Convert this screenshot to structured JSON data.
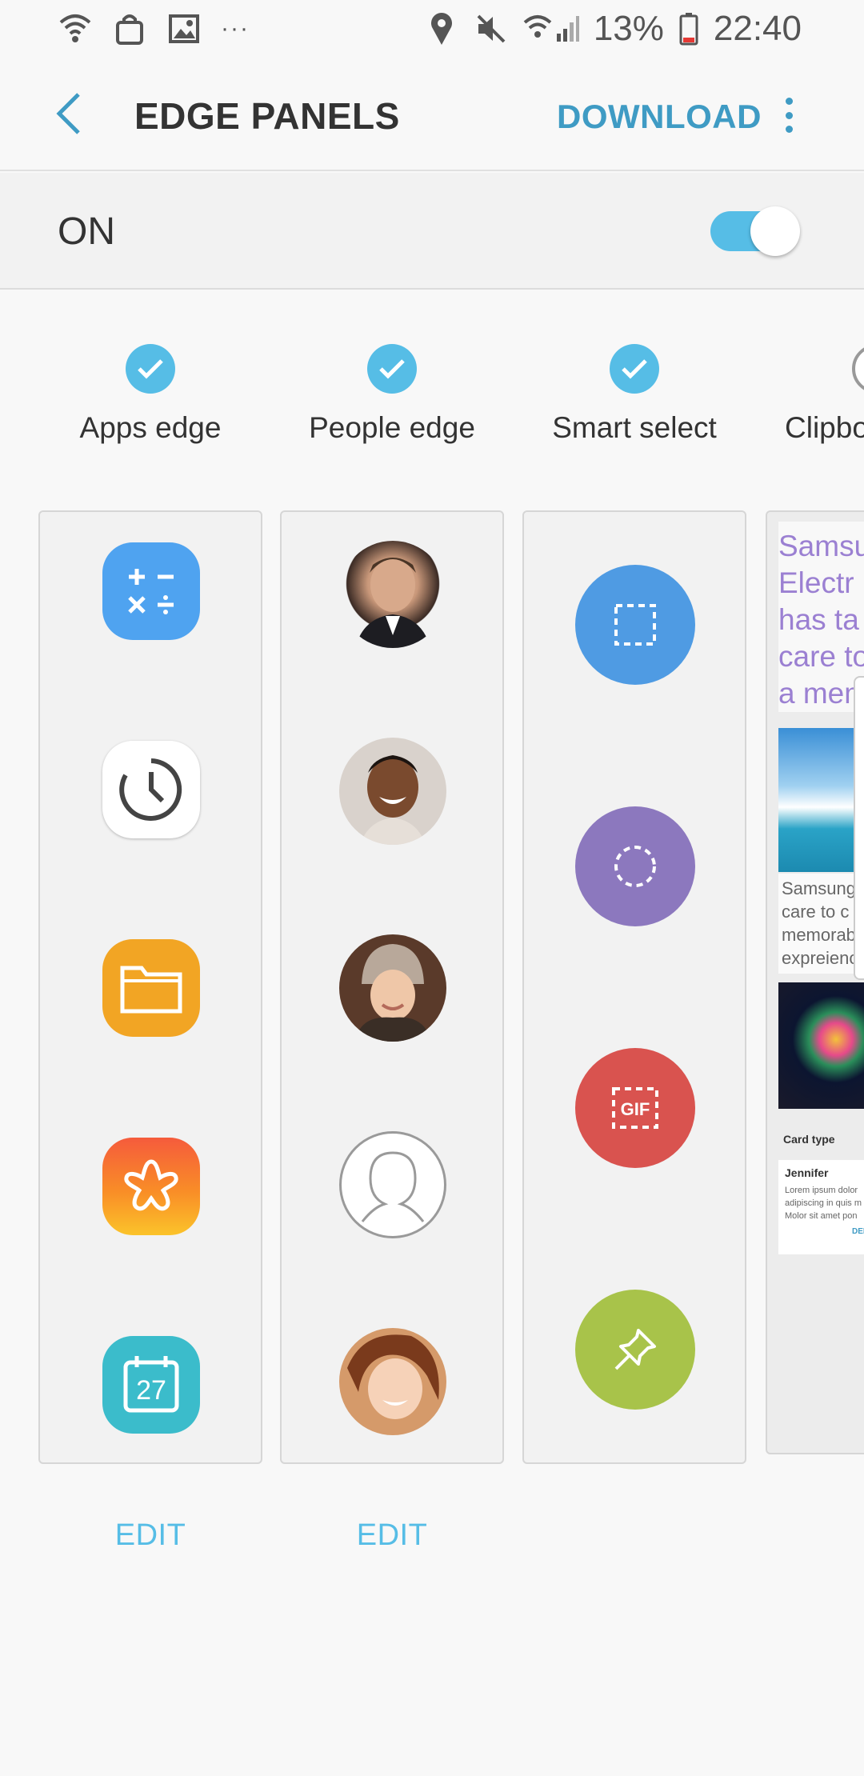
{
  "status_bar": {
    "battery": "13%",
    "time": "22:40",
    "more": "···"
  },
  "header": {
    "title": "EDGE PANELS",
    "download": "DOWNLOAD"
  },
  "master_switch": {
    "label": "ON",
    "state": "on"
  },
  "panels": [
    {
      "name": "Apps edge",
      "checked": true,
      "edit": "EDIT"
    },
    {
      "name": "People edge",
      "checked": true,
      "edit": "EDIT"
    },
    {
      "name": "Smart select",
      "checked": true
    },
    {
      "name": "Clipboard",
      "checked": false
    }
  ],
  "apps_edge": {
    "icons": [
      "calculator-icon",
      "clock-icon",
      "my-files-icon",
      "gallery-icon",
      "calendar-icon"
    ],
    "calendar_day": "27"
  },
  "people_edge": {
    "contacts": [
      "contact-1",
      "contact-2",
      "contact-3",
      "contact-4",
      "contact-5"
    ]
  },
  "smart_select": {
    "tools": [
      "rectangle",
      "oval",
      "animation",
      "pin-to-screen"
    ],
    "gif_label": "GIF"
  },
  "clipboard": {
    "headline": [
      "Samsu",
      "Electr",
      "has ta",
      "care to",
      "a mem"
    ],
    "caption": [
      "Samsung",
      "care to c",
      "memorab",
      "expreienc"
    ],
    "card_type": "Card type",
    "note_title": "Jennifer",
    "note_body": [
      "Lorem ipsum dolor",
      "adipiscing in quis m",
      "Molor sit amet pon"
    ],
    "note_action": "DEL"
  },
  "colors": {
    "accent": "#56bde6",
    "header_accent": "#3f9bc4",
    "select_rect": "#4f9be3",
    "select_oval": "#8c78be",
    "select_gif": "#d9534f",
    "select_pin": "#a8c34a"
  }
}
